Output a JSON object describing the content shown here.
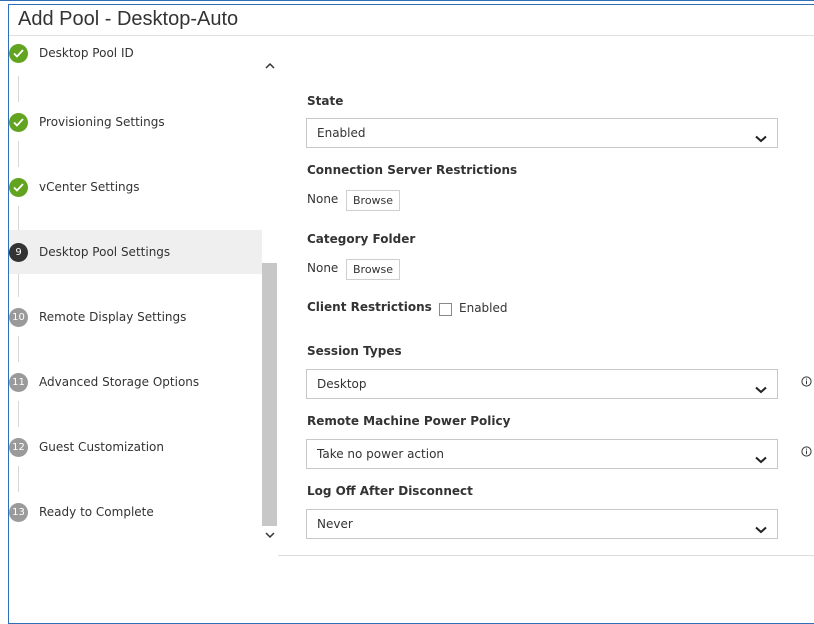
{
  "header": {
    "title": "Add Pool - Desktop-Auto"
  },
  "steps": [
    {
      "badge": "",
      "label": "Desktop Pool ID",
      "status": "done"
    },
    {
      "badge": "",
      "label": "Provisioning Settings",
      "status": "done"
    },
    {
      "badge": "",
      "label": "vCenter Settings",
      "status": "done"
    },
    {
      "badge": "9",
      "label": "Desktop Pool Settings",
      "status": "current"
    },
    {
      "badge": "10",
      "label": "Remote Display Settings",
      "status": "pending"
    },
    {
      "badge": "11",
      "label": "Advanced Storage Options",
      "status": "pending"
    },
    {
      "badge": "12",
      "label": "Guest Customization",
      "status": "pending"
    },
    {
      "badge": "13",
      "label": "Ready to Complete",
      "status": "pending"
    }
  ],
  "form": {
    "state": {
      "label": "State",
      "value": "Enabled"
    },
    "connection_server": {
      "label": "Connection Server Restrictions",
      "value": "None",
      "button": "Browse"
    },
    "category_folder": {
      "label": "Category Folder",
      "value": "None",
      "button": "Browse"
    },
    "client_restrictions": {
      "label": "Client Restrictions",
      "checkbox_label": "Enabled",
      "checked": false
    },
    "session_types": {
      "label": "Session Types",
      "value": "Desktop"
    },
    "power_policy": {
      "label": "Remote Machine Power Policy",
      "value": "Take no power action"
    },
    "log_off": {
      "label": "Log Off After Disconnect",
      "value": "Never"
    }
  },
  "colors": {
    "done": "#62a420",
    "current": "#333333",
    "pending": "#9a9a9a",
    "border": "#2f6fb7"
  },
  "icons": {
    "done": "check-icon",
    "info": "info-icon",
    "select": "chevron-down-icon"
  }
}
